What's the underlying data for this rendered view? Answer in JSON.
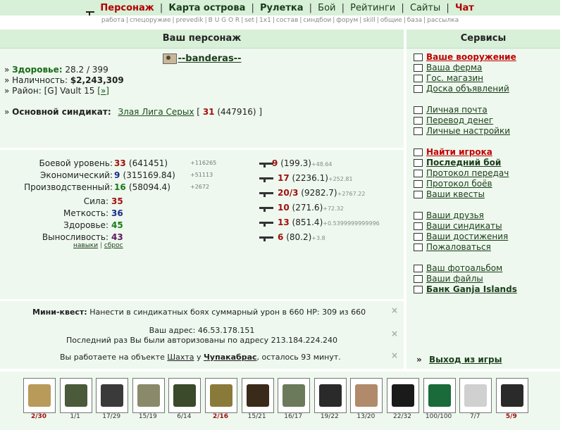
{
  "nav": {
    "items": [
      {
        "label": "Персонаж",
        "active": true
      },
      {
        "label": "Карта острова"
      },
      {
        "label": "Рулетка"
      },
      {
        "label": "Бой"
      },
      {
        "label": "Рейтинги"
      },
      {
        "label": "Сайты"
      },
      {
        "label": "Чат"
      }
    ],
    "sub": [
      "работа",
      "спецоружие",
      "prevedik",
      "B U G O R",
      "set",
      "1x1",
      "состав",
      "синдбои",
      "форум",
      "skill",
      "общие",
      "база",
      "рассылка"
    ]
  },
  "left_header": "Ваш персонаж",
  "right_header": "Сервисы",
  "character": {
    "name": "--banderas--",
    "health_label": "Здоровье:",
    "health_value": "28.2 / 399",
    "cash_label": "Наличность:",
    "cash_value": "$2,243,309",
    "district_label": "Район:",
    "district_value": "[G] Vault 15",
    "district_link": "[»]",
    "syndicate_label": "Основной синдикат:",
    "syndicate_name": "Злая Лига Серых",
    "syndicate_bracket_open": "[",
    "syndicate_level": "31",
    "syndicate_points": "(447916)",
    "syndicate_bracket_close": "]"
  },
  "levels": [
    {
      "label": "Боевой уровень:",
      "value": "33",
      "rest": "(641451)",
      "inc": "+116265"
    },
    {
      "label": "Экономический:",
      "value": "9",
      "rest": "(315169.84)",
      "inc": "+51113"
    },
    {
      "label": "Производственный:",
      "value": "16",
      "rest": "(58094.4)",
      "inc": "+2672"
    }
  ],
  "attributes": [
    {
      "label": "Сила:",
      "value": "35"
    },
    {
      "label": "Меткость:",
      "value": "36"
    },
    {
      "label": "Здоровье:",
      "value": "45"
    },
    {
      "label": "Выносливость:",
      "value": "43"
    }
  ],
  "skills_links": {
    "skills": "навыки",
    "sep": "|",
    "reset": "сброс"
  },
  "weapons": [
    {
      "value": "9",
      "rest": "(199.3)",
      "inc": "+48.64"
    },
    {
      "value": "17",
      "rest": "(2236.1)",
      "inc": "+252.81"
    },
    {
      "value": "20/3",
      "rest": "(9282.7)",
      "inc": "+2767.22"
    },
    {
      "value": "10",
      "rest": "(271.6)",
      "inc": "+72.32"
    },
    {
      "value": "13",
      "rest": "(851.4)",
      "inc": "+0.5399999999996"
    },
    {
      "value": "6",
      "rest": "(80.2)",
      "inc": "+3.8"
    }
  ],
  "mini_quest": {
    "label": "Мини-квест:",
    "text": "Нанести в синдикатных боях суммарный урон в 660 HP: 309 из 660"
  },
  "address": {
    "line1": "Ваш адрес: 46.53.178.151",
    "line2": "Последний раз Вы были авторизованы по адресу 213.184.224.240"
  },
  "work": {
    "prefix": "Вы работаете на объекте",
    "object": "Шахта",
    "mid": "у",
    "owner": "Чупакабрас",
    "suffix": ", осталось 93 минут."
  },
  "close_glyph": "×",
  "services": [
    {
      "label": "Ваше вооружение",
      "style": "red",
      "icon": "gun-icon"
    },
    {
      "label": "Ваша ферма",
      "icon": "farm-icon"
    },
    {
      "label": "Гос. магазин",
      "icon": "shop-icon"
    },
    {
      "label": "Доска объявлений",
      "icon": "board-icon"
    },
    {
      "label": "Личная почта",
      "icon": "mail-icon"
    },
    {
      "label": "Перевод денег",
      "icon": "transfer-icon"
    },
    {
      "label": "Личные настройки",
      "icon": "settings-icon"
    },
    {
      "label": "Найти игрока",
      "style": "red",
      "icon": "search-icon"
    },
    {
      "label": "Последний бой",
      "style": "bold",
      "icon": "battle-icon"
    },
    {
      "label": "Протокол передач",
      "icon": "transfer-log-icon"
    },
    {
      "label": "Протокол боёв",
      "icon": "battle-log-icon"
    },
    {
      "label": "Ваши квесты",
      "icon": "quest-icon"
    },
    {
      "label": "Ваши друзья",
      "icon": "friends-icon"
    },
    {
      "label": "Ваши синдикаты",
      "icon": "syndicate-icon"
    },
    {
      "label": "Ваши достижения",
      "icon": "achievement-icon"
    },
    {
      "label": "Пожаловаться",
      "icon": "complain-icon"
    },
    {
      "label": "Ваш фотоальбом",
      "icon": "photo-icon"
    },
    {
      "label": "Ваши файлы",
      "icon": "files-icon"
    },
    {
      "label": "Банк Ganja Islands",
      "style": "bold",
      "icon": "bank-icon"
    }
  ],
  "exit": {
    "arrow": "»",
    "label": "Выход из игры"
  },
  "inventory": [
    {
      "item": "rifle",
      "count": "2/30",
      "alert": true,
      "color": "#b89a5a"
    },
    {
      "item": "grenade",
      "count": "1/1",
      "color": "#4a5a3a"
    },
    {
      "item": "device",
      "count": "17/29",
      "color": "#3a3a3a"
    },
    {
      "item": "helmet",
      "count": "15/19",
      "color": "#8a8a6a"
    },
    {
      "item": "vest",
      "count": "6/14",
      "color": "#3a4a2a"
    },
    {
      "item": "ghillie",
      "count": "2/16",
      "alert": true,
      "color": "#8a7a3a"
    },
    {
      "item": "boots",
      "count": "15/21",
      "color": "#3a2a1a"
    },
    {
      "item": "tank",
      "count": "16/17",
      "color": "#6a7a5a"
    },
    {
      "item": "phone",
      "count": "19/22",
      "color": "#2a2a2a"
    },
    {
      "item": "watch",
      "count": "13/20",
      "color": "#b08a6a"
    },
    {
      "item": "binoculars",
      "count": "22/32",
      "color": "#1a1a1a"
    },
    {
      "item": "badge",
      "count": "100/100",
      "color": "#1a6a3a"
    },
    {
      "item": "gloves",
      "count": "7/7",
      "color": "#d0d0d0"
    },
    {
      "item": "flashlight",
      "count": "5/9",
      "alert": true,
      "color": "#2a2a2a"
    }
  ]
}
